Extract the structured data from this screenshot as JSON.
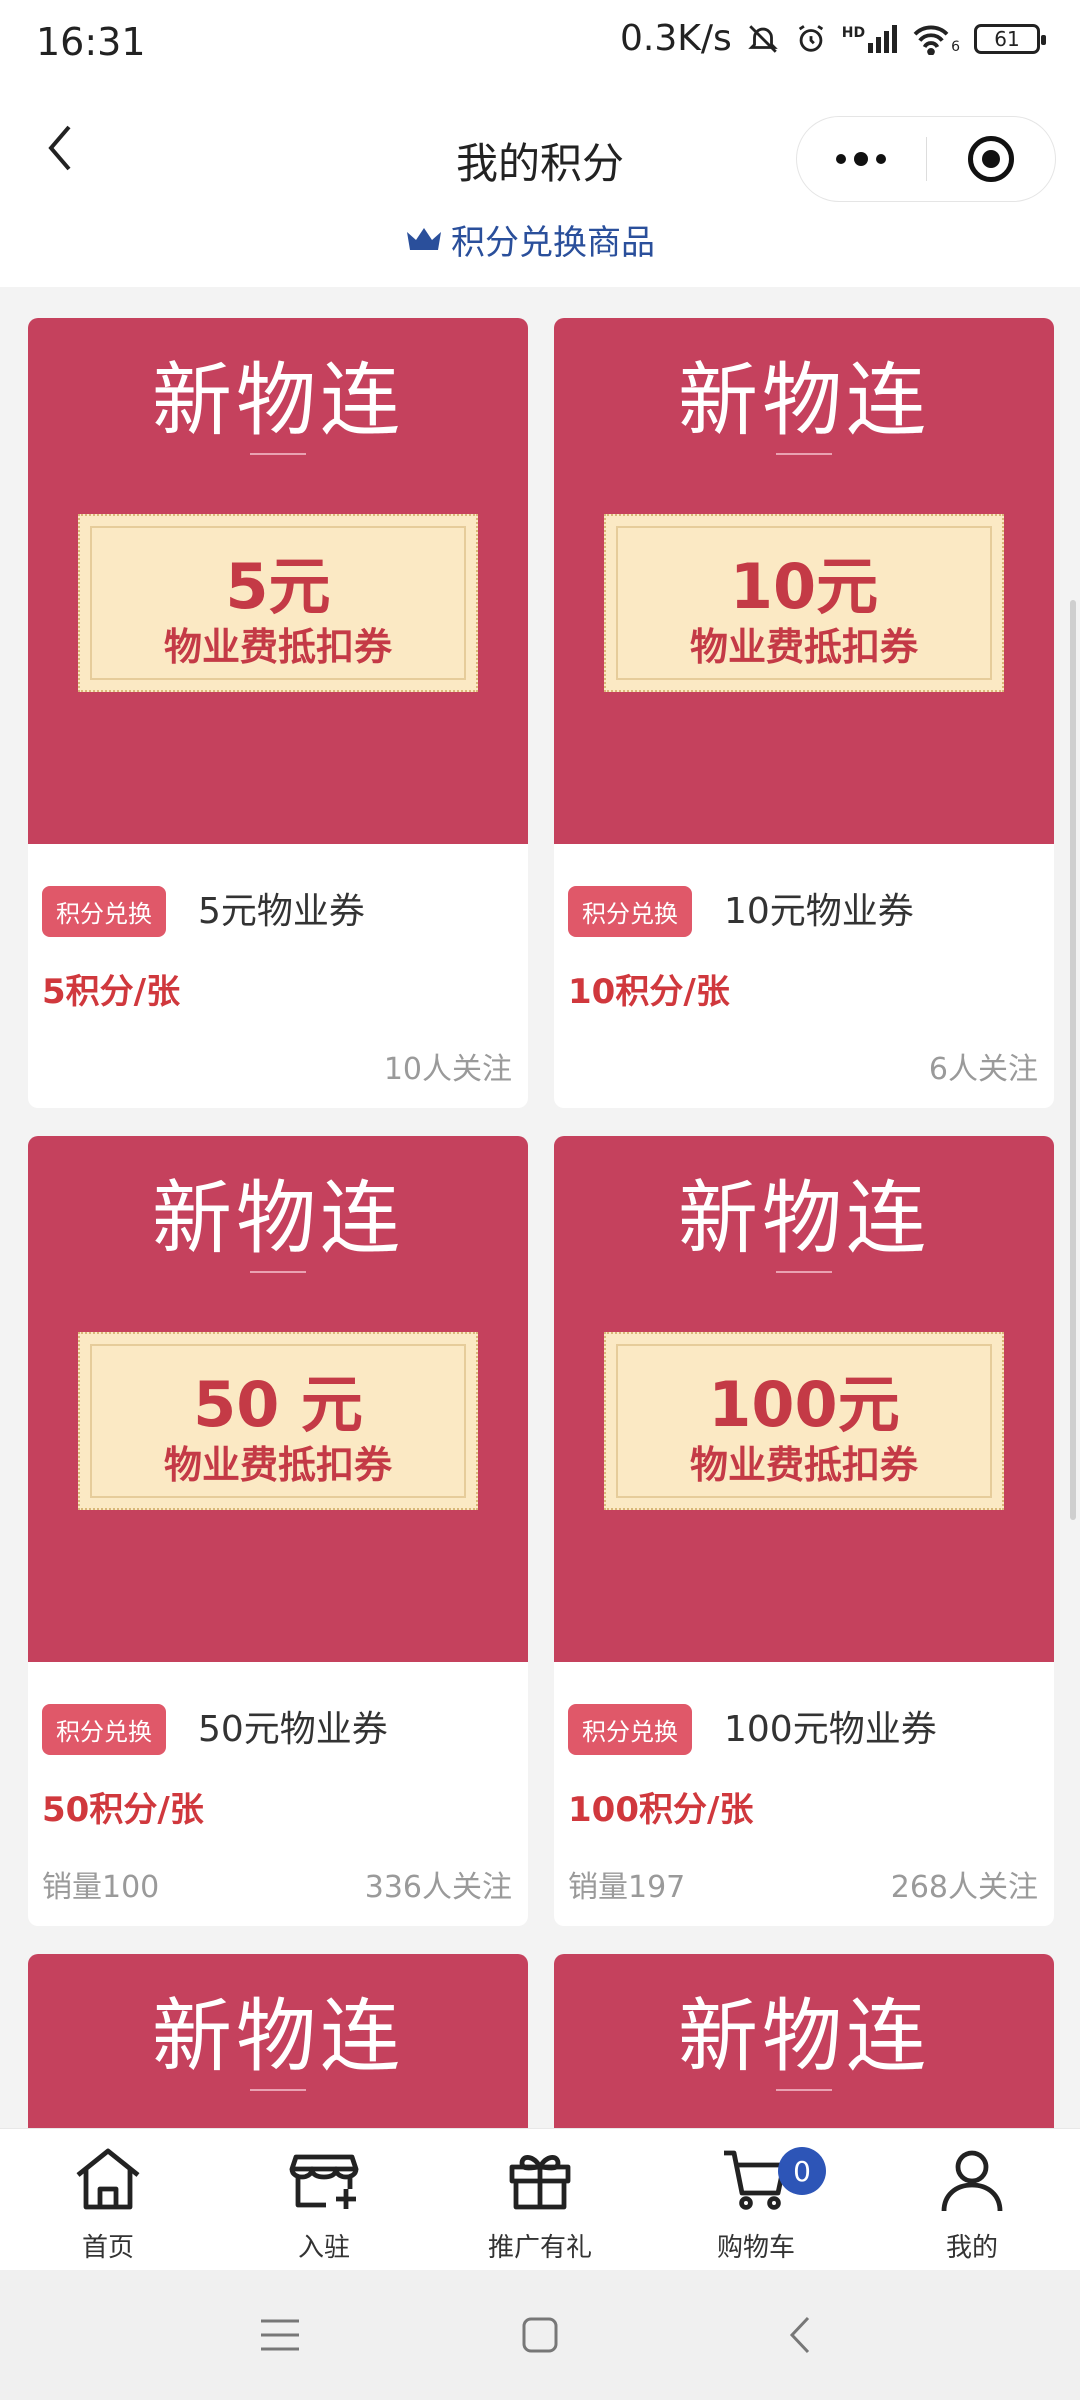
{
  "status_bar": {
    "time": "16:31",
    "net_speed": "0.3K/s",
    "signal_label": "HD",
    "wifi_sub": "6",
    "battery": "61"
  },
  "nav": {
    "title": "我的积分"
  },
  "section": {
    "title": "积分兑换商品"
  },
  "products": [
    {
      "brand": "新物连",
      "ticket_value": "5元",
      "ticket_desc": "物业费抵扣券",
      "badge": "积分兑换",
      "name": "5元物业券",
      "price": "5积分/张",
      "sales": "",
      "follows": "10人关注"
    },
    {
      "brand": "新物连",
      "ticket_value": "10元",
      "ticket_desc": "物业费抵扣券",
      "badge": "积分兑换",
      "name": "10元物业券",
      "price": "10积分/张",
      "sales": "",
      "follows": "6人关注"
    },
    {
      "brand": "新物连",
      "ticket_value": "50 元",
      "ticket_desc": "物业费抵扣券",
      "badge": "积分兑换",
      "name": "50元物业券",
      "price": "50积分/张",
      "sales": "销量100",
      "follows": "336人关注"
    },
    {
      "brand": "新物连",
      "ticket_value": "100元",
      "ticket_desc": "物业费抵扣券",
      "badge": "积分兑换",
      "name": "100元物业券",
      "price": "100积分/张",
      "sales": "销量197",
      "follows": "268人关注"
    },
    {
      "brand": "新物连"
    },
    {
      "brand": "新物连"
    }
  ],
  "tab_bar": {
    "items": [
      {
        "label": "首页",
        "icon": "home-icon"
      },
      {
        "label": "入驻",
        "icon": "store-add-icon"
      },
      {
        "label": "推广有礼",
        "icon": "gift-icon"
      },
      {
        "label": "购物车",
        "icon": "cart-icon"
      },
      {
        "label": "我的",
        "icon": "user-icon"
      }
    ],
    "cart_count": "0"
  },
  "colors": {
    "card_red": "#c5415d",
    "price_red": "#d0383d",
    "badge_red": "#e05869",
    "accent_blue": "#2d55b7"
  }
}
